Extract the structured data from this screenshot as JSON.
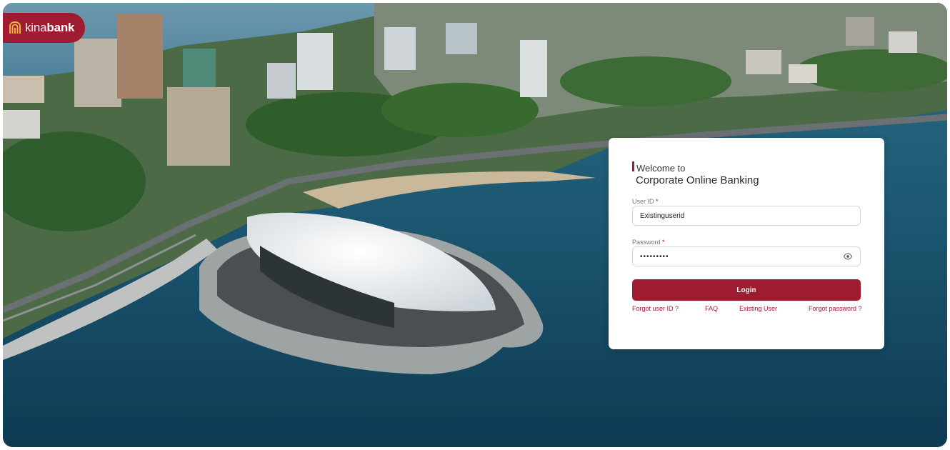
{
  "brand": {
    "logo_text_thin": "kina",
    "logo_text_bold": "bank",
    "logo_icon": "kinabank-wave-icon",
    "color": "#9e1b32"
  },
  "background": {
    "description_icon": "port-moresby-aerial-photo"
  },
  "login": {
    "welcome": "Welcome to",
    "heading": "Corporate Online Banking",
    "user_label": "User ID",
    "password_label": "Password",
    "required_mark": "*",
    "user_value": "Existinguserid",
    "password_value": "•••••••••",
    "show_password_icon": "eye-icon",
    "login_label": "Login",
    "links": {
      "forgot_user": "Forgot user ID ?",
      "faq": "FAQ",
      "existing_user": "Existing User",
      "forgot_password": "Forgot password ?"
    }
  }
}
